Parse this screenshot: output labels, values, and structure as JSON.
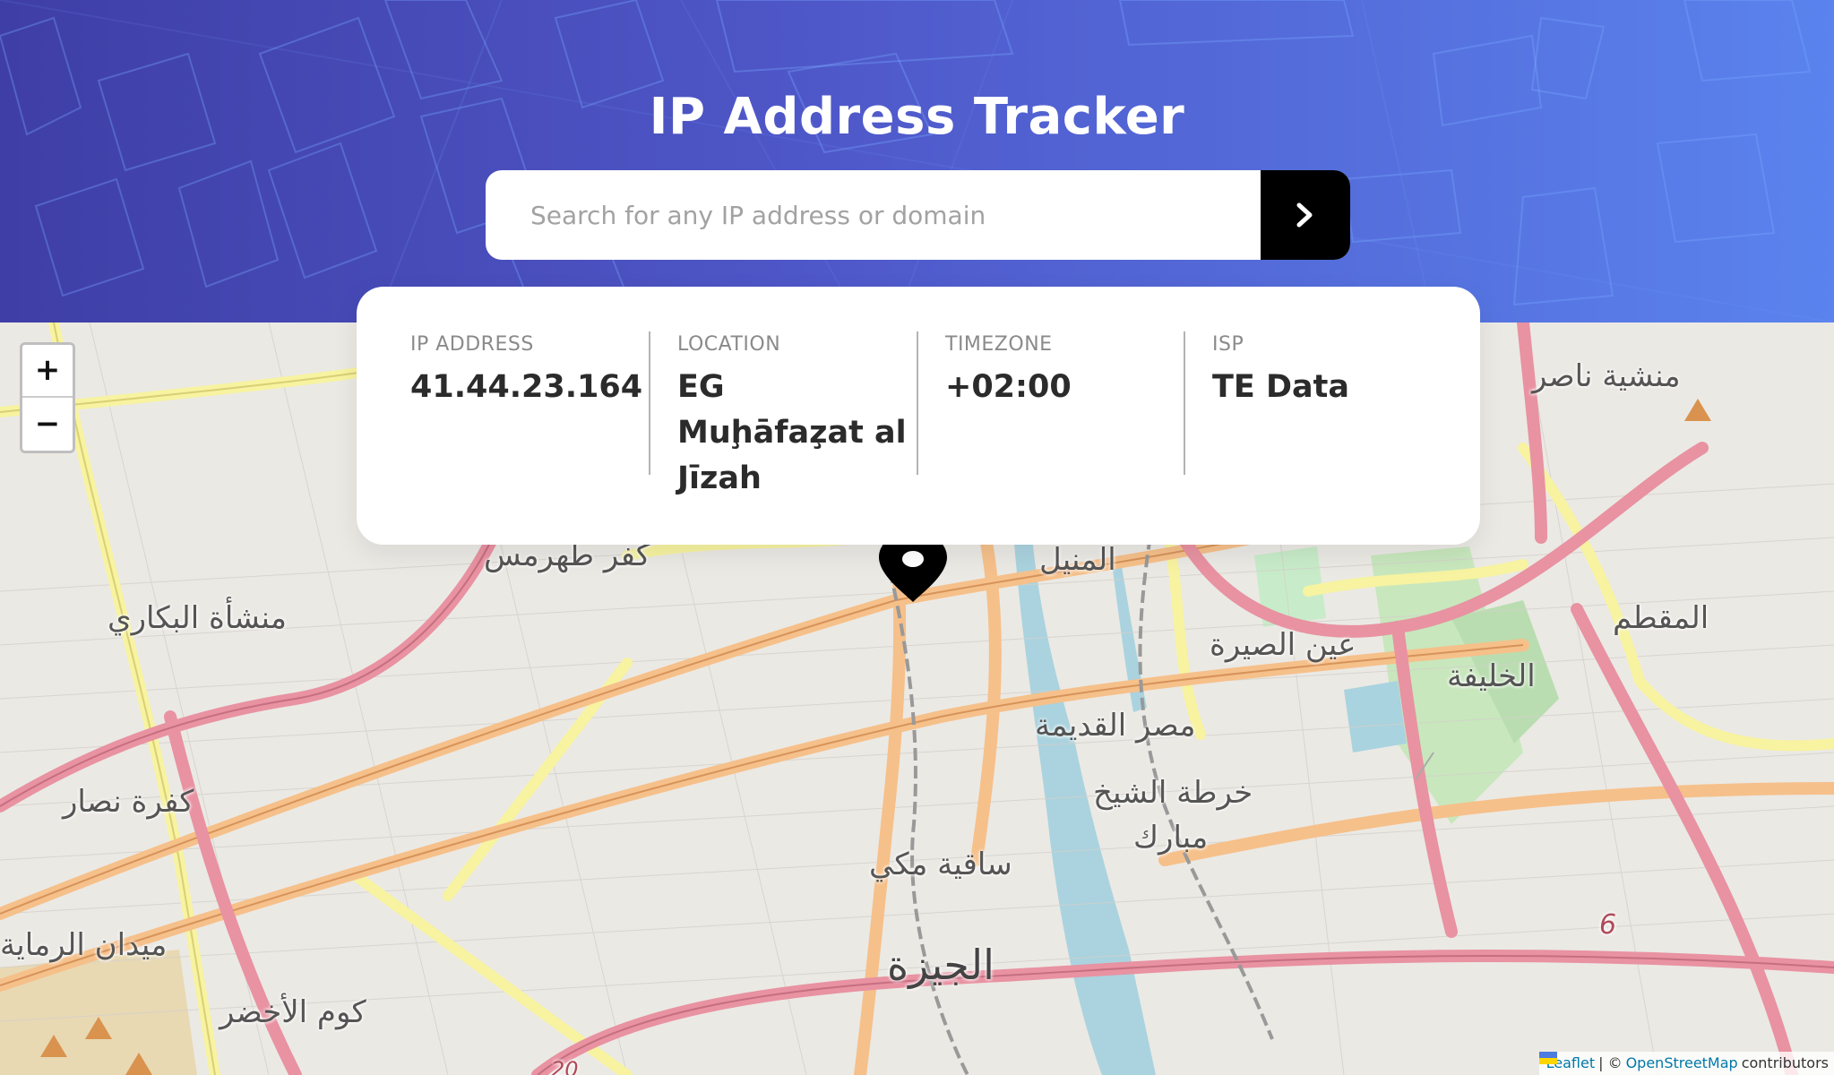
{
  "header": {
    "title": "IP Address Tracker"
  },
  "search": {
    "placeholder": "Search for any IP address or domain",
    "value": ""
  },
  "info": {
    "ip": {
      "label": "IP ADDRESS",
      "value": "41.44.23.164"
    },
    "location": {
      "label": "LOCATION",
      "value_line1": "EG",
      "value_line2": "Muḩāfaz̧at al",
      "value_line3": "Jīzah"
    },
    "timezone": {
      "label": "TIMEZONE",
      "value": "+02:00"
    },
    "isp": {
      "label": "ISP",
      "value": "TE Data"
    }
  },
  "map": {
    "zoom_in": "+",
    "zoom_out": "−",
    "attribution": {
      "leaflet": "Leaflet",
      "separator": "| ©",
      "osm": "OpenStreetMap",
      "contributors": "contributors"
    },
    "labels": [
      {
        "text": "منشية ناصر"
      },
      {
        "text": "كفر طهرمس"
      },
      {
        "text": "المنيل"
      },
      {
        "text": "منشأة البكاري"
      },
      {
        "text": "عين الصيرة"
      },
      {
        "text": "المقطم"
      },
      {
        "text": "الخليفة"
      },
      {
        "text": "مصر القديمة"
      },
      {
        "text": "خرطة الشيخ"
      },
      {
        "text": "مبارك"
      },
      {
        "text": "كفرة نصار"
      },
      {
        "text": "ساقية مكي"
      },
      {
        "text": "ميدان الرماية"
      },
      {
        "text": "الجيزة"
      },
      {
        "text": "كوم الأخضر"
      },
      {
        "text": "6"
      },
      {
        "text": "20"
      }
    ]
  },
  "colors": {
    "gradient_start": "#3f3ea6",
    "gradient_end": "#5a83ee",
    "button_bg": "#000000",
    "marker": "#000000"
  },
  "icons": {
    "search_button": "chevron-right-icon",
    "marker": "location-pin-icon"
  }
}
